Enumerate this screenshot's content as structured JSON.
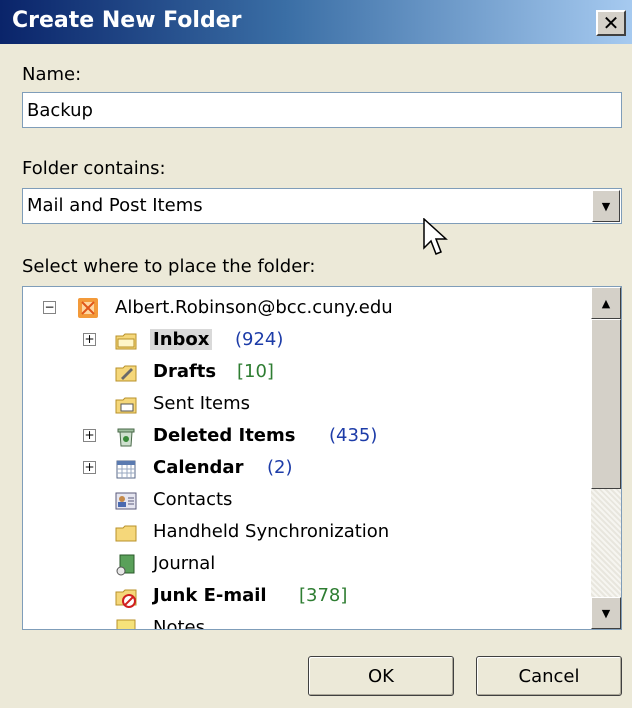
{
  "dialog": {
    "title": "Create New Folder",
    "close_label": "✕"
  },
  "name_field": {
    "label": "Name:",
    "value": "Backup"
  },
  "folder_contains": {
    "label": "Folder contains:",
    "value": "Mail and Post Items"
  },
  "place_label": "Select where to place the folder:",
  "tree": {
    "root": {
      "name": "Albert.Robinson@bcc.cuny.edu",
      "expander": "−"
    },
    "items": [
      {
        "name": "Inbox",
        "count": "(924)",
        "bold": true,
        "expander": "+",
        "icon": "inbox-icon"
      },
      {
        "name": "Drafts",
        "count": "[10]",
        "bold": true,
        "expander": "",
        "icon": "drafts-icon"
      },
      {
        "name": "Sent Items",
        "count": "",
        "bold": false,
        "expander": "",
        "icon": "sent-items-icon"
      },
      {
        "name": "Deleted Items",
        "count": "(435)",
        "bold": true,
        "expander": "+",
        "icon": "deleted-items-icon"
      },
      {
        "name": "Calendar",
        "count": "(2)",
        "bold": true,
        "expander": "+",
        "icon": "calendar-icon"
      },
      {
        "name": "Contacts",
        "count": "",
        "bold": false,
        "expander": "",
        "icon": "contacts-icon"
      },
      {
        "name": "Handheld Synchronization",
        "count": "",
        "bold": false,
        "expander": "",
        "icon": "folder-icon"
      },
      {
        "name": "Journal",
        "count": "",
        "bold": false,
        "expander": "",
        "icon": "journal-icon"
      },
      {
        "name": "Junk E-mail",
        "count": "[378]",
        "bold": true,
        "expander": "",
        "icon": "junk-email-icon"
      },
      {
        "name": "Notes",
        "count": "",
        "bold": false,
        "expander": "",
        "icon": "notes-icon"
      }
    ]
  },
  "buttons": {
    "ok": "OK",
    "cancel": "Cancel"
  },
  "colors": {
    "title_start": "#0a246a",
    "count_blue": "#1d3ca8",
    "count_green": "#2e7d32"
  }
}
